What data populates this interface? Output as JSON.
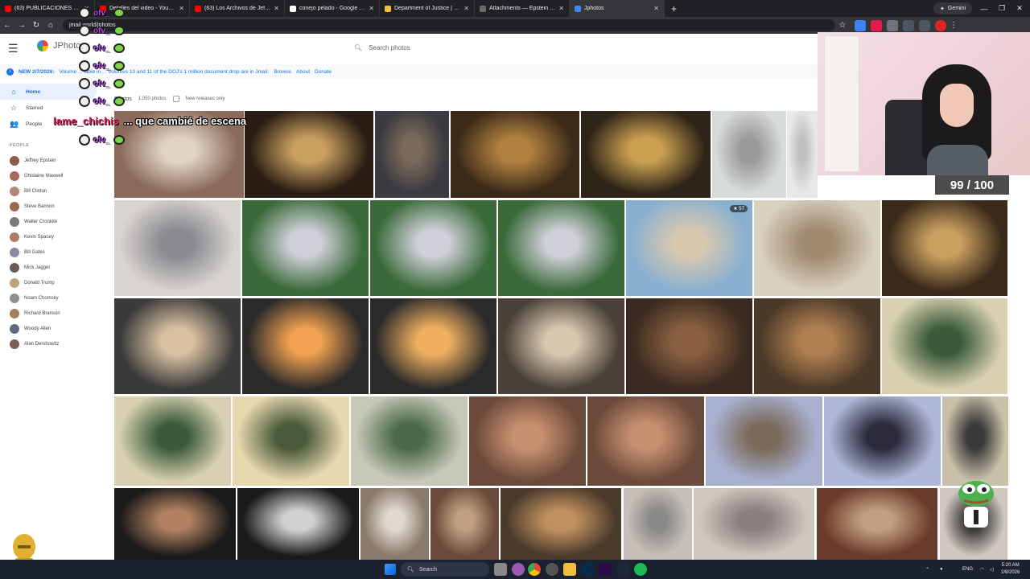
{
  "browser": {
    "tabs": [
      {
        "title": "(63) PUBLICACIONES #1 - You",
        "color": "#ff0000"
      },
      {
        "title": "Detalles del video - YouTube St",
        "color": "#ff0000"
      },
      {
        "title": "(63) Los Archivos de Jeffrey Eps",
        "color": "#ff0000"
      },
      {
        "title": "conejo pelado - Google Search",
        "color": "#ffffff"
      },
      {
        "title": "Department of Justice | Homep",
        "color": "#f0c040"
      },
      {
        "title": "Attachments — Epstein Emails",
        "color": "#6a6a6a"
      },
      {
        "title": "Jphotos",
        "color": "#4285f4"
      }
    ],
    "new_tab": "+",
    "gemini_label": "Gemini",
    "url": "jmail.world/jphotos",
    "win_min": "—",
    "win_max": "❐",
    "win_close": "✕",
    "tab_close": "✕"
  },
  "app": {
    "logo_text": "JPhotos",
    "search_placeholder": "Search photos",
    "banner": {
      "new_label": "NEW 2/7/2026:",
      "text": "Volume ... table in ... Volumes 10 and 11 of the DOJ's 1 million document drop are in Jmail.",
      "browse": "Browse",
      "about": "About",
      "donate": "Donate"
    },
    "nav": [
      {
        "label": "Home",
        "icon": "⌂",
        "active": true
      },
      {
        "label": "Starred",
        "icon": "☆",
        "active": false
      },
      {
        "label": "People",
        "icon": "👥",
        "active": false
      }
    ],
    "people_header": "PEOPLE",
    "people": [
      {
        "name": "Jeffrey Epstein",
        "color": "#8a5a4a"
      },
      {
        "name": "Ghislaine Maxwell",
        "color": "#a66a5a"
      },
      {
        "name": "Bill Clinton",
        "color": "#b08878"
      },
      {
        "name": "Steve Bannon",
        "color": "#9a6a50"
      },
      {
        "name": "Walter Cronkite",
        "color": "#7a7a7a"
      },
      {
        "name": "Kevin Spacey",
        "color": "#b07a60"
      },
      {
        "name": "Bill Gates",
        "color": "#8a8aa0"
      },
      {
        "name": "Mick Jagger",
        "color": "#6a5a5a"
      },
      {
        "name": "Donald Trump",
        "color": "#c0a080"
      },
      {
        "name": "Noam Chomsky",
        "color": "#909090"
      },
      {
        "name": "Richard Branson",
        "color": "#a08060"
      },
      {
        "name": "Woody Allen",
        "color": "#5a6a7a"
      },
      {
        "name": "Alan Dershowitz",
        "color": "#7a6050"
      }
    ],
    "grid_title": "Photos",
    "photo_count": "1,050 photos",
    "new_releases_label": "New releases only",
    "star_badge": "★ 57"
  },
  "overlay": {
    "chat_user": "ofv_",
    "big_chat_user": "lame_chichis",
    "big_chat_msg": "... que cambié de escena",
    "counter": "99 / 100"
  },
  "taskbar": {
    "search_label": "Search",
    "lang": "ENG",
    "time": "5:20 AM",
    "date": "2/8/2026"
  }
}
